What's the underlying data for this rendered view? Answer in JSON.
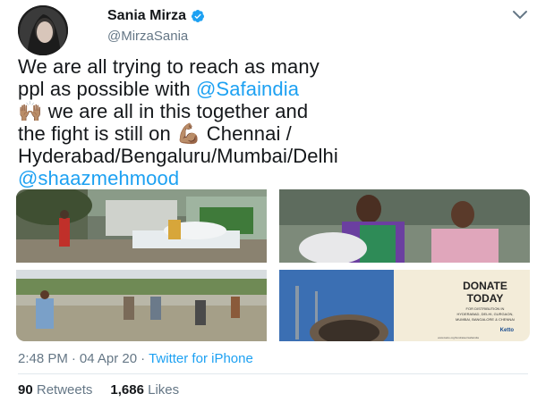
{
  "user": {
    "display_name": "Sania Mirza",
    "handle": "@MirzaSania",
    "verified": true
  },
  "tweet": {
    "line1": "We are all trying to reach as many",
    "line2_pre": "ppl as possible with ",
    "mention1": "@Safaindia",
    "emoji_hands": "🙌🏽",
    "line3_rest": " we are all in this together and",
    "line4_pre": "the fight is still on ",
    "emoji_muscle": "💪🏽",
    "line4_post": " Chennai /",
    "line5": "Hyderabad/Bengaluru/Mumbai/Delhi",
    "mention2": "@shaazmehmood"
  },
  "media": {
    "donate_title_1": "DONATE",
    "donate_title_2": "TODAY",
    "donate_sub_1": "FOR DISTRIBUTION IN",
    "donate_sub_2": "HYDERABAD, DELHI, GURGAON,",
    "donate_sub_3": "MUMBAI, BANGALORE & CHENNAI",
    "donate_brand": "Ketto",
    "donate_url": "www.ketto.org/fundraiser/safaindia"
  },
  "meta": {
    "time": "2:48 PM",
    "sep1": "·",
    "date": "04 Apr 20",
    "sep2": "·",
    "source": "Twitter for iPhone"
  },
  "stats": {
    "retweets_count": "90",
    "retweets_label": "Retweets",
    "likes_count": "1,686",
    "likes_label": "Likes"
  },
  "colors": {
    "link": "#1da1f2",
    "secondary": "#657786",
    "text": "#14171a"
  },
  "icons": [
    "avatar",
    "verified-icon",
    "chevron-down-icon"
  ]
}
